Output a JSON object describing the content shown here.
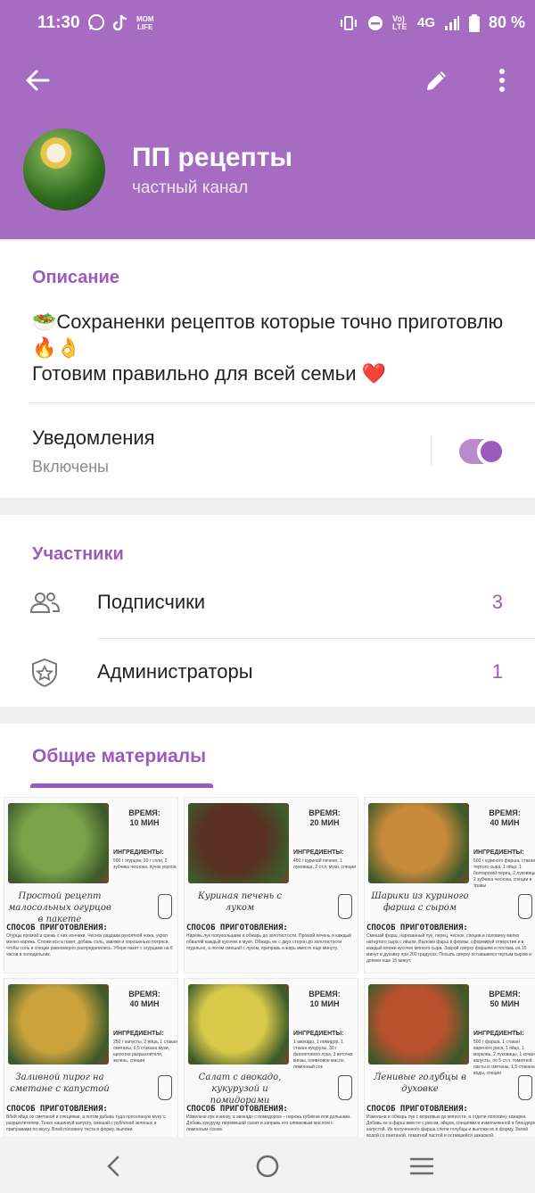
{
  "status_bar": {
    "time": "11:30",
    "left_icons": [
      "whatsapp-icon",
      "tiktok-icon",
      "mom-life-icon"
    ],
    "right_icons": [
      "vibrate-icon",
      "dnd-icon",
      "volte-icon",
      "4g-icon",
      "signal-icon",
      "battery-icon"
    ],
    "volte_label": "Vo) LTE",
    "network_label": "4G",
    "battery": "80 %"
  },
  "header": {
    "title": "ПП рецепты",
    "subtitle": "частный канал",
    "back_icon": "arrow-left-icon",
    "edit_icon": "pencil-icon",
    "more_icon": "more-vertical-icon",
    "color": "#a56cc1"
  },
  "description": {
    "title": "Описание",
    "line1": "🥗Сохраненки рецептов которые точно приготовлю 🔥👌",
    "line2": "Готовим правильно для всей семьи ❤️"
  },
  "notifications": {
    "label": "Уведомления",
    "status": "Включены",
    "enabled": true
  },
  "members": {
    "title": "Участники",
    "rows": [
      {
        "label": "Подписчики",
        "count": "3",
        "icon": "people-icon"
      },
      {
        "label": "Администраторы",
        "count": "1",
        "icon": "shield-star-icon"
      }
    ]
  },
  "media": {
    "tab_label": "Общие материалы",
    "tiles": [
      {
        "time": "ВРЕМЯ:\n10 МИН",
        "ingredients_title": "ИНГРЕДИЕНТЫ:",
        "ingredients": "500 г огурцов, 10 г соли, 2 зубчика чеснока, пучок укропа",
        "caption": "Простой рецепт малосольных огурцов в пакете",
        "method_title": "СПОСОБ ПРИГОТОВЛЕНИЯ:",
        "method": "Огурцы промой и срежь с них кончики. Чеснок раздави рукояткой ножа, укроп мелко нарежь. Сложи все в пакет, добавь соль, завяжи и хорошенько потряси, чтобы соль и специи равномерно распределились. Убери пакет с огурцами на 6 часов в холодильник.",
        "photo": "#7aa34a"
      },
      {
        "time": "ВРЕМЯ:\n20 МИН",
        "ingredients_title": "ИНГРЕДИЕНТЫ:",
        "ingredients": "450 г куриной печени, 1 луковица, 2 ст.л. муки, специи",
        "caption": "Куриная печень с луком",
        "method_title": "СПОСОБ ПРИГОТОВЛЕНИЯ:",
        "method": "Нарежь лук полукольцами и обжарь до золотистости. Промой печень и каждый обваляй каждый кусочек в муке. Обжарь ее с двух сторон до золотистости отдельно, а потом смешай с луком, приправь и жарь вместе еще минуту.",
        "photo": "#5a2f24"
      },
      {
        "time": "ВРЕМЯ:\n40 МИН",
        "ingredients_title": "ИНГРЕДИЕНТЫ:",
        "ingredients": "500 г куриного фарша, стакан тертого сыра, 1 яйцо, 1 болгарский перец, 2 луковицы, 2 зубчика чеснока, специи и травы",
        "caption": "Шарики из куриного фарша с сыром",
        "method_title": "СПОСОБ ПРИГОТОВЛЕНИЯ:",
        "method": "Смешай фарш, нарезанный лук, перец, чеснок, специи и половину мелко натертого сыра с яйцом. Выложи фарш в формы, сформируй отверстия и в каждый вложи кусочек мягкого сыра. Закрой сверху фаршем и поставь на 15 минут в духовку при 200 градусах. Посыпь сверху оставшимся тертым сыром и допеки еще 15 минут.",
        "photo": "#c88a3c"
      },
      {
        "time": "ВРЕМЯ:\n40 МИН",
        "ingredients_title": "ИНГРЕДИЕНТЫ:",
        "ingredients": "250 г капусты, 2 яйца, 1 стакан сметаны, 0,5 стакана муки, щепотка разрыхлителя, зелень, специи",
        "caption": "Заливной пирог на сметане с капустой",
        "method_title": "СПОСОБ ПРИГОТОВЛЕНИЯ:",
        "method": "Вбей яйца со сметаной и специями, а потом добавь туда просеянную муку с разрыхлителем. Тонко нашинкуй капусту, смешай с рубленой зеленью и приправами по вкусу. Влей половину теста в форму, выложи",
        "photo": "#c9a23c"
      },
      {
        "time": "ВРЕМЯ:\n10 МИН",
        "ingredients_title": "ИНГРЕДИЕНТЫ:",
        "ingredients": "1 авокадо, 1 помидор, 1 стакан кукурузы, 30 г фиолетового лука, 3 веточки кинзы, оливковое масло, лимонный сок",
        "caption": "Салат с авокадо, кукурузой и помидорами",
        "method_title": "СПОСОБ ПРИГОТОВЛЕНИЯ:",
        "method": "Измельчи лук и кинзу, а авокадо с помидором – нарежь кубиком или дольками. Добавь кукурузу, перемешай салат и заправь его оливковым маслом с лимонным соком.",
        "photo": "#d9c94a"
      },
      {
        "time": "ВРЕМЯ:\n50 МИН",
        "ingredients_title": "ИНГРЕДИЕНТЫ:",
        "ingredients": "500 г фарша, 1 стакан вареного риса, 1 яйцо, 1 морковь, 2 луковицы, 1 кочан капусты, по 5 ст.л. томатной пасты и сметаны, 1,5 стакана воды, специи",
        "caption": "Ленивые голубцы в духовке",
        "method_title": "СПОСОБ ПРИГОТОВЛЕНИЯ:",
        "method": "Измельчи и обжарь лук с морковью до мягкости, и отдели половину зажарки. Добавь ее в фарш вместе с рисом, яйцом, специями и измельченной в блендере капустой. Из полученного фарша слепи голубцы и выложи их в форму. Залей водой со сметаной, томатной пастой и оставшейся зажаркой.",
        "photo": "#b8512e"
      }
    ]
  },
  "nav": {
    "back_icon": "nav-back-icon",
    "home_icon": "nav-home-icon",
    "recents_icon": "nav-recents-icon"
  },
  "colors": {
    "accent": "#9b5bbd",
    "header": "#a56cc1"
  }
}
